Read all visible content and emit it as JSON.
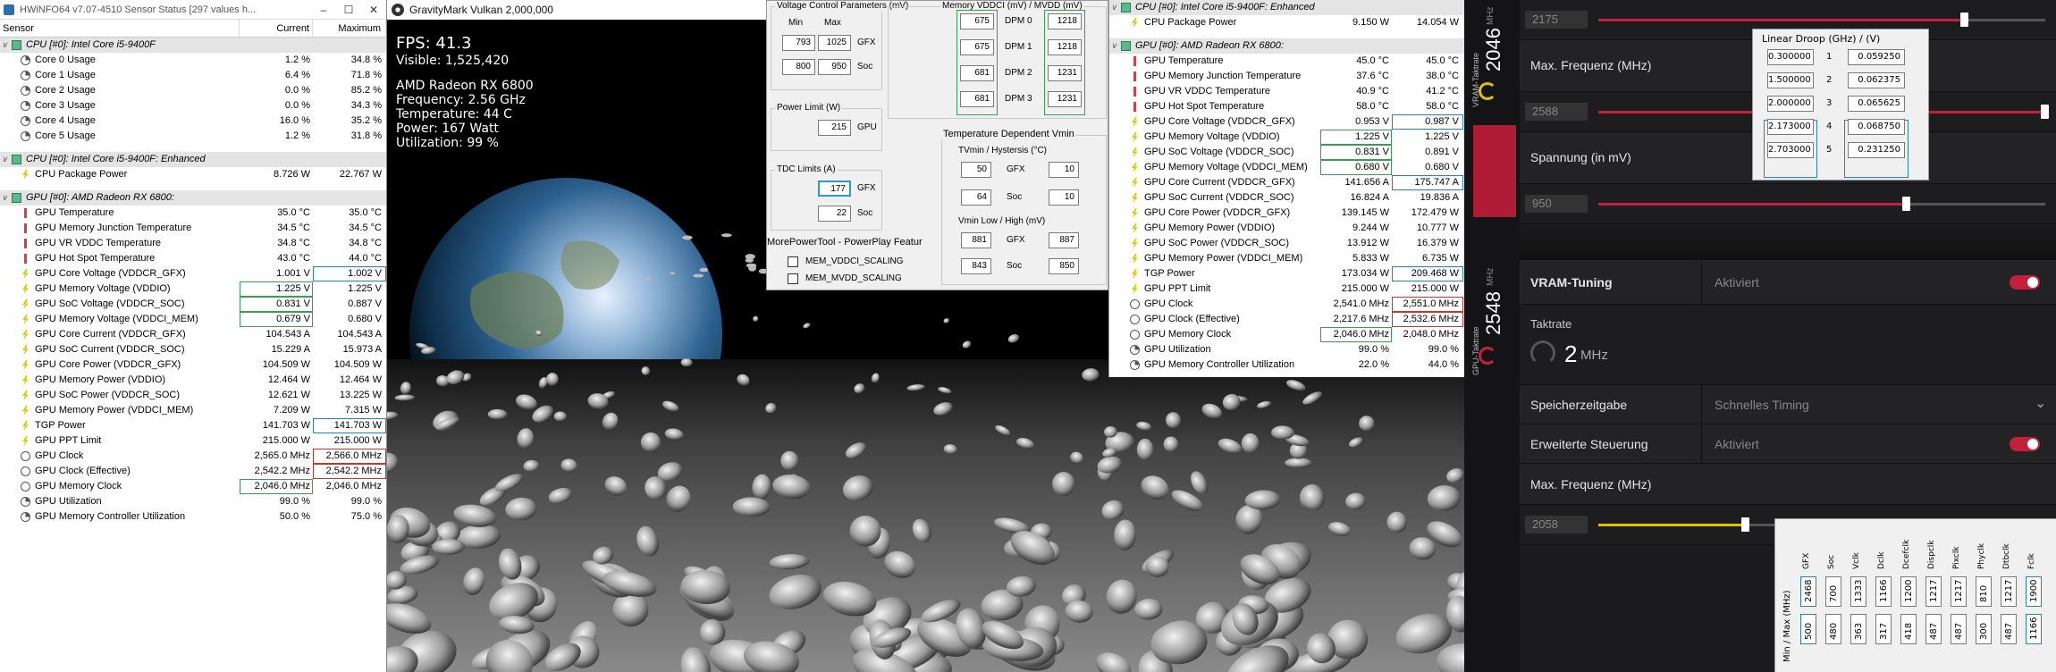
{
  "hwinfo_left": {
    "title": "HWiNFO64 v7.07-4510 Sensor Status [297 values h...",
    "window_controls": [
      "–",
      "☐",
      "✕"
    ],
    "headers": [
      "Sensor",
      "Current",
      "Maximum"
    ],
    "rows": [
      {
        "type": "group",
        "label": "CPU [#0]: Intel Core i5-9400F"
      },
      {
        "type": "row",
        "icon": "pct",
        "label": "Core 0 Usage",
        "cur": "1.2 %",
        "max": "34.8 %"
      },
      {
        "type": "row",
        "icon": "pct",
        "label": "Core 1 Usage",
        "cur": "6.4 %",
        "max": "71.8 %"
      },
      {
        "type": "row",
        "icon": "pct",
        "label": "Core 2 Usage",
        "cur": "0.0 %",
        "max": "85.2 %"
      },
      {
        "type": "row",
        "icon": "pct",
        "label": "Core 3 Usage",
        "cur": "0.0 %",
        "max": "34.3 %"
      },
      {
        "type": "row",
        "icon": "pct",
        "label": "Core 4 Usage",
        "cur": "16.0 %",
        "max": "35.2 %"
      },
      {
        "type": "row",
        "icon": "pct",
        "label": "Core 5 Usage",
        "cur": "1.2 %",
        "max": "31.8 %"
      },
      {
        "type": "gap"
      },
      {
        "type": "group",
        "label": "CPU [#0]: Intel Core i5-9400F: Enhanced"
      },
      {
        "type": "row",
        "icon": "volt",
        "label": "CPU Package Power",
        "cur": "8.726 W",
        "max": "22.767 W"
      },
      {
        "type": "gap"
      },
      {
        "type": "group",
        "label": "GPU [#0]: AMD Radeon RX 6800:"
      },
      {
        "type": "row",
        "icon": "therm",
        "label": "GPU Temperature",
        "cur": "35.0 °C",
        "max": "35.0 °C"
      },
      {
        "type": "row",
        "icon": "therm",
        "label": "GPU Memory Junction Temperature",
        "cur": "34.5 °C",
        "max": "34.5 °C"
      },
      {
        "type": "row",
        "icon": "therm",
        "label": "GPU VR VDDC Temperature",
        "cur": "34.8 °C",
        "max": "34.8 °C"
      },
      {
        "type": "row",
        "icon": "therm",
        "label": "GPU Hot Spot Temperature",
        "cur": "43.0 °C",
        "max": "44.0 °C"
      },
      {
        "type": "row",
        "icon": "volt",
        "label": "GPU Core Voltage (VDDCR_GFX)",
        "cur": "1.001 V",
        "max": "1.002 V",
        "box3": "b"
      },
      {
        "type": "row",
        "icon": "volt",
        "label": "GPU Memory Voltage (VDDIO)",
        "cur": "1.225 V",
        "max": "1.225 V",
        "box2": "g"
      },
      {
        "type": "row",
        "icon": "volt",
        "label": "GPU SoC Voltage (VDDCR_SOC)",
        "cur": "0.831 V",
        "max": "0.887 V",
        "box2": "g"
      },
      {
        "type": "row",
        "icon": "volt",
        "label": "GPU Memory Voltage (VDDCI_MEM)",
        "cur": "0.679 V",
        "max": "0.680 V",
        "box2": "g"
      },
      {
        "type": "row",
        "icon": "volt",
        "label": "GPU Core Current (VDDCR_GFX)",
        "cur": "104.543 A",
        "max": "104.543 A"
      },
      {
        "type": "row",
        "icon": "volt",
        "label": "GPU SoC Current (VDDCR_SOC)",
        "cur": "15.229 A",
        "max": "15.973 A"
      },
      {
        "type": "row",
        "icon": "volt",
        "label": "GPU Core Power (VDDCR_GFX)",
        "cur": "104.509 W",
        "max": "104.509 W"
      },
      {
        "type": "row",
        "icon": "volt",
        "label": "GPU Memory Power (VDDIO)",
        "cur": "12.464 W",
        "max": "12.464 W"
      },
      {
        "type": "row",
        "icon": "volt",
        "label": "GPU SoC Power (VDDCR_SOC)",
        "cur": "12.621 W",
        "max": "13.225 W"
      },
      {
        "type": "row",
        "icon": "volt",
        "label": "GPU Memory Power (VDDCI_MEM)",
        "cur": "7.209 W",
        "max": "7.315 W"
      },
      {
        "type": "row",
        "icon": "volt",
        "label": "TGP Power",
        "cur": "141.703 W",
        "max": "141.703 W",
        "box3": "b"
      },
      {
        "type": "row",
        "icon": "volt",
        "label": "GPU PPT Limit",
        "cur": "215.000 W",
        "max": "215.000 W"
      },
      {
        "type": "row",
        "icon": "clock",
        "label": "GPU Clock",
        "cur": "2,565.0 MHz",
        "max": "2,566.0 MHz",
        "box3": "r"
      },
      {
        "type": "row",
        "icon": "clock",
        "label": "GPU Clock (Effective)",
        "cur": "2,542.2 MHz",
        "max": "2,542.2 MHz",
        "box3": "r"
      },
      {
        "type": "row",
        "icon": "clock",
        "label": "GPU Memory Clock",
        "cur": "2,046.0 MHz",
        "max": "2,046.0 MHz",
        "box2": "g"
      },
      {
        "type": "row",
        "icon": "pct",
        "label": "GPU Utilization",
        "cur": "99.0 %",
        "max": "99.0 %"
      },
      {
        "type": "row",
        "icon": "pct",
        "label": "GPU Memory Controller Utilization",
        "cur": "50.0 %",
        "max": "75.0 %"
      }
    ]
  },
  "gravitymark": {
    "title": "GravityMark Vulkan 2,000,000",
    "fps": "FPS: 41.3",
    "visible": "Visible: 1,525,420",
    "gpu": "AMD Radeon RX 6800",
    "frequency": "Frequency: 2.56 GHz",
    "temperature": "Temperature: 44 C",
    "power": "Power: 167 Watt",
    "utilization": "Utilization: 99 %"
  },
  "mpt": {
    "voltage_title": "Voltage Control Parameters (mV)",
    "min_label": "Min",
    "max_label": "Max",
    "gfx_min": "793",
    "gfx_max": "1025",
    "gfx_label": "GFX",
    "soc_min": "800",
    "soc_max": "950",
    "soc_label": "Soc",
    "power_limit_title": "Power Limit (W)",
    "power_limit": "215",
    "gpu_label": "GPU",
    "tdc_title": "TDC Limits (A)",
    "tdc_gfx": "177",
    "tdc_soc": "22",
    "footer": "MorePowerTool - PowerPlay Featur",
    "mem_title": "Memory VDDCI (mV) / MVDD (mV)",
    "dpm": [
      {
        "label": "DPM 0",
        "vddci": "675",
        "mvdd": "1218"
      },
      {
        "label": "DPM 1",
        "vddci": "675",
        "mvdd": "1218"
      },
      {
        "label": "DPM 2",
        "vddci": "681",
        "mvdd": "1231"
      },
      {
        "label": "DPM 3",
        "vddci": "681",
        "mvdd": "1231"
      }
    ],
    "temp_title": "Temperature Dependent Vmin",
    "tvmin_title": "TVmin / Hystersis (°C)",
    "tv_gfx_a": "50",
    "tv_gfx_b": "10",
    "tv_soc_a": "64",
    "tv_soc_b": "10",
    "vmin_title": "Vmin Low / High (mV)",
    "vm_gfx_a": "881",
    "vm_gfx_b": "887",
    "vm_soc_a": "843",
    "vm_soc_b": "850",
    "cb1": "MEM_VDDCI_SCALING",
    "cb2": "MEM_MVDD_SCALING"
  },
  "hwinfo_right": {
    "rows": [
      {
        "type": "group",
        "label": "CPU [#0]: Intel Core i5-9400F: Enhanced"
      },
      {
        "type": "row",
        "icon": "volt",
        "label": "CPU Package Power",
        "cur": "9.150 W",
        "max": "14.054 W"
      },
      {
        "type": "gap"
      },
      {
        "type": "group",
        "label": "GPU [#0]: AMD Radeon RX 6800:"
      },
      {
        "type": "row",
        "icon": "therm",
        "label": "GPU Temperature",
        "cur": "45.0 °C",
        "max": "45.0 °C"
      },
      {
        "type": "row",
        "icon": "therm",
        "label": "GPU Memory Junction Temperature",
        "cur": "37.6 °C",
        "max": "38.0 °C"
      },
      {
        "type": "row",
        "icon": "therm",
        "label": "GPU VR VDDC Temperature",
        "cur": "40.9 °C",
        "max": "41.2 °C"
      },
      {
        "type": "row",
        "icon": "therm",
        "label": "GPU Hot Spot Temperature",
        "cur": "58.0 °C",
        "max": "58.0 °C"
      },
      {
        "type": "row",
        "icon": "volt",
        "label": "GPU Core Voltage (VDDCR_GFX)",
        "cur": "0.953 V",
        "max": "0.987 V",
        "box3": "b"
      },
      {
        "type": "row",
        "icon": "volt",
        "label": "GPU Memory Voltage (VDDIO)",
        "cur": "1.225 V",
        "max": "1.225 V",
        "box2": "g"
      },
      {
        "type": "row",
        "icon": "volt",
        "label": "GPU SoC Voltage (VDDCR_SOC)",
        "cur": "0.831 V",
        "max": "0.891 V",
        "box2": "g"
      },
      {
        "type": "row",
        "icon": "volt",
        "label": "GPU Memory Voltage (VDDCI_MEM)",
        "cur": "0.680 V",
        "max": "0.680 V",
        "box2": "g"
      },
      {
        "type": "row",
        "icon": "volt",
        "label": "GPU Core Current (VDDCR_GFX)",
        "cur": "141.656 A",
        "max": "175.747 A",
        "box3": "b"
      },
      {
        "type": "row",
        "icon": "volt",
        "label": "GPU SoC Current (VDDCR_SOC)",
        "cur": "16.824 A",
        "max": "19.836 A"
      },
      {
        "type": "row",
        "icon": "volt",
        "label": "GPU Core Power (VDDCR_GFX)",
        "cur": "139.145 W",
        "max": "172.479 W"
      },
      {
        "type": "row",
        "icon": "volt",
        "label": "GPU Memory Power (VDDIO)",
        "cur": "9.244 W",
        "max": "10.777 W"
      },
      {
        "type": "row",
        "icon": "volt",
        "label": "GPU SoC Power (VDDCR_SOC)",
        "cur": "13.912 W",
        "max": "16.379 W"
      },
      {
        "type": "row",
        "icon": "volt",
        "label": "GPU Memory Power (VDDCI_MEM)",
        "cur": "5.833 W",
        "max": "6.735 W"
      },
      {
        "type": "row",
        "icon": "volt",
        "label": "TGP Power",
        "cur": "173.034 W",
        "max": "209.468 W",
        "box3": "b"
      },
      {
        "type": "row",
        "icon": "volt",
        "label": "GPU PPT Limit",
        "cur": "215.000 W",
        "max": "215.000 W"
      },
      {
        "type": "row",
        "icon": "clock",
        "label": "GPU Clock",
        "cur": "2,541.0 MHz",
        "max": "2,551.0 MHz",
        "box3": "r"
      },
      {
        "type": "row",
        "icon": "clock",
        "label": "GPU Clock (Effective)",
        "cur": "2,217.6 MHz",
        "max": "2,532.6 MHz",
        "box3": "r"
      },
      {
        "type": "row",
        "icon": "clock",
        "label": "GPU Memory Clock",
        "cur": "2,046.0 MHz",
        "max": "2,048.0 MHz",
        "box2": "g"
      },
      {
        "type": "row",
        "icon": "pct",
        "label": "GPU Utilization",
        "cur": "99.0 %",
        "max": "99.0 %"
      },
      {
        "type": "row",
        "icon": "pct",
        "label": "GPU Memory Controller Utilization",
        "cur": "22.0 %",
        "max": "44.0 %"
      }
    ]
  },
  "radeon": {
    "vram_vertical": "VRAM-Taktrate",
    "vram_vertical_val": "2046",
    "vram_vertical_unit": "MHz",
    "gpu_vertical": "GPU-Taktrate",
    "gpu_vertical_val": "2548",
    "gpu_vertical_unit": "MHz",
    "slider1_val": "2175",
    "max_freq_label": "Max. Frequenz (MHz)",
    "slider2_val": "2588",
    "spannung_label": "Spannung (in mV)",
    "slider3_val": "950",
    "vram_tuning": "VRAM-Tuning",
    "vram_tuning_state": "Aktiviert",
    "taktrate_label": "Taktrate",
    "taktrate_val": "2",
    "taktrate_unit": "MHz",
    "speicher_label": "Speicherzeitgabe",
    "speicher_val": "Schnelles Timing",
    "erweitert_label": "Erweiterte Steuerung",
    "erweitert_state": "Aktiviert",
    "max_freq2_label": "Max. Frequenz (MHz)",
    "slider4_val": "2058",
    "accent": "#c4203a",
    "slider1_level": 0.82,
    "slider2_level": 1.0,
    "slider3_level": 0.69,
    "slider4_level": 0.33
  },
  "linear_droop": {
    "title": "Linear Droop (GHz) / (V)",
    "rows": [
      {
        "ghz": "0.300000",
        "n": "1",
        "v": "0.059250"
      },
      {
        "ghz": "1.500000",
        "n": "2",
        "v": "0.062375"
      },
      {
        "ghz": "2.000000",
        "n": "3",
        "v": "0.065625"
      },
      {
        "ghz": "2.173000",
        "n": "4",
        "v": "0.068750"
      },
      {
        "ghz": "2.703000",
        "n": "5",
        "v": "0.231250"
      }
    ]
  },
  "dpm_table": {
    "side_label": "Min / Max (MHz)",
    "cols": [
      {
        "name": "GFX",
        "max": "2468",
        "min": "500"
      },
      {
        "name": "Soc",
        "max": "700",
        "min": "480"
      },
      {
        "name": "Vclk",
        "max": "1333",
        "min": "363"
      },
      {
        "name": "Dclk",
        "max": "1166",
        "min": "317"
      },
      {
        "name": "Dcefclk",
        "max": "1200",
        "min": "418"
      },
      {
        "name": "Dispclk",
        "max": "1217",
        "min": "487"
      },
      {
        "name": "Pixclk",
        "max": "1217",
        "min": "487"
      },
      {
        "name": "Phyclk",
        "max": "810",
        "min": "300"
      },
      {
        "name": "Dtbclk",
        "max": "1217",
        "min": "487"
      },
      {
        "name": "Fclk",
        "max": "1900",
        "min": "1166"
      }
    ]
  }
}
